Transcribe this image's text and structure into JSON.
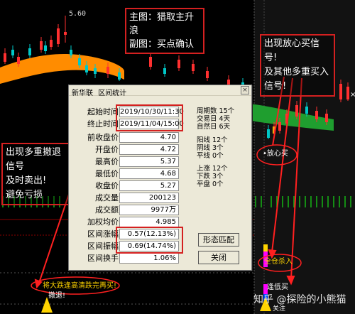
{
  "price_label": "5.60",
  "title_box": {
    "line1": "主图：猎取主升浪",
    "line2": "副图：买点确认"
  },
  "top_right_box": {
    "line1": "出现放心买信号!",
    "line2": "及其他多重买入",
    "line3": "信号!"
  },
  "left_box": {
    "line1": "出现多重撤退信号",
    "line2": "及时卖出!",
    "line3": "避免亏损"
  },
  "chart_signals": {
    "fangxinmai": "•放心买",
    "full_buy": "全仓杀入",
    "low_buy": "逢低买",
    "attention": "关注",
    "bottom_left": "将大跌逢高清跌完再买!",
    "chetui": "撤退!"
  },
  "dialog": {
    "app_name": "新华联",
    "title": "区间统计",
    "close_icon": "×",
    "start_label": "起始时间",
    "start_value": "2019/10/30/11:30",
    "end_label": "终止时间",
    "end_value": "2019/11/04/15:00",
    "stats_top": [
      {
        "label": "周期数",
        "value": "15个"
      },
      {
        "label": "交易日",
        "value": "4天"
      },
      {
        "label": "自然日",
        "value": "6天"
      }
    ],
    "rows": [
      {
        "label": "前收盘价",
        "value": "4.70"
      },
      {
        "label": "开盘价",
        "value": "4.72"
      },
      {
        "label": "最高价",
        "value": "5.37"
      },
      {
        "label": "最低价",
        "value": "4.68"
      },
      {
        "label": "收盘价",
        "value": "5.27"
      },
      {
        "label": "成交量",
        "value": "200123"
      },
      {
        "label": "成交额",
        "value": "9977万"
      },
      {
        "label": "加权均价",
        "value": "4.985"
      },
      {
        "label": "区间涨幅",
        "value": "0.57(12.13%)"
      },
      {
        "label": "区间振幅",
        "value": "0.69(14.74%)"
      },
      {
        "label": "区间换手",
        "value": "1.06%"
      }
    ],
    "stats_mid": [
      {
        "label": "阳线",
        "value": "12个"
      },
      {
        "label": "阴线",
        "value": "3个"
      },
      {
        "label": "平线",
        "value": "0个"
      }
    ],
    "stats_low": [
      {
        "label": "上涨",
        "value": "12个"
      },
      {
        "label": "下跌",
        "value": "3个"
      },
      {
        "label": "平盘",
        "value": "0个"
      }
    ],
    "btn_pattern": "形态匹配",
    "btn_close": "关闭"
  },
  "watermark": "知乎 @探险的小熊猫",
  "colors": {
    "up": "#ff3030",
    "down": "#00c8c8",
    "band_orange": "#ff8c00",
    "band_green": "#1f9e2f",
    "annotation_box": "#d42020"
  }
}
